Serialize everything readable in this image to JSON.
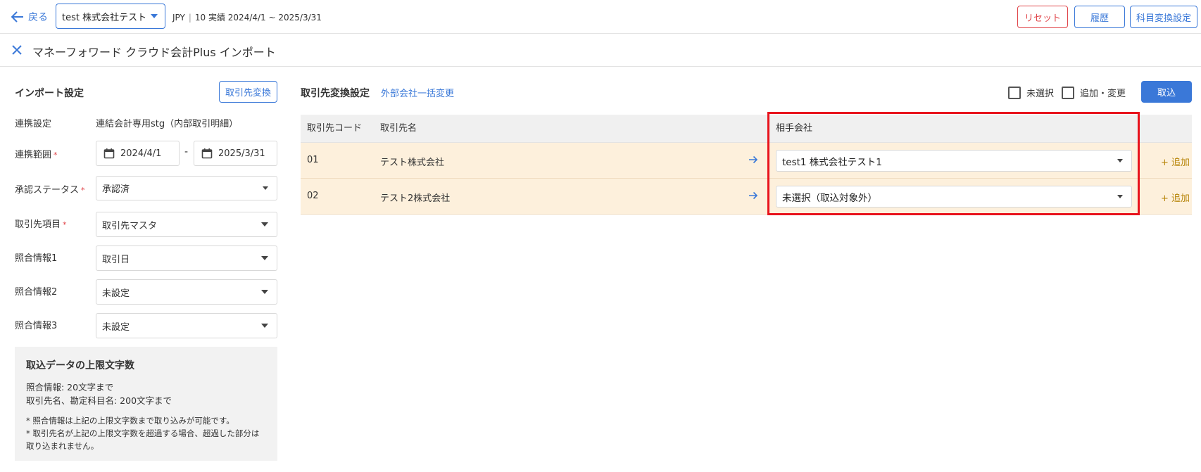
{
  "topbar": {
    "back_label": "戻る",
    "company": "test 株式会社テスト",
    "currency": "JPY",
    "period": "10 実績 2024/4/1 ~ 2025/3/31",
    "reset_label": "リセット",
    "history_label": "履歴",
    "account_mapping_label": "科目変換設定"
  },
  "subheader": {
    "title": "マネーフォワード クラウド会計Plus インポート"
  },
  "import_settings": {
    "title": "インポート設定",
    "partner_convert_button": "取引先変換",
    "link_label": "連携設定",
    "link_value": "連結会計専用stg（内部取引明細）",
    "range_label": "連携範囲",
    "range_required": "*",
    "range_start": "2024/4/1",
    "range_dash": "-",
    "range_end": "2025/3/31",
    "approval_label": "承認ステータス",
    "approval_required": "*",
    "approval_value": "承認済",
    "partner_item_label": "取引先項目",
    "partner_item_required": "*",
    "partner_item_value": "取引先マスタ",
    "match1_label": "照合情報1",
    "match1_value": "取引日",
    "match2_label": "照合情報2",
    "match2_value": "未設定",
    "match3_label": "照合情報3",
    "match3_value": "未設定"
  },
  "limits": {
    "title": "取込データの上限文字数",
    "line1": "照合情報: 20文字まで",
    "line2": "取引先名、勘定科目名: 200文字まで",
    "note1": "* 照合情報は上記の上限文字数まで取り込みが可能です。",
    "note2": "* 取引先名が上記の上限文字数を超過する場合、超過した部分は取り込まれません。"
  },
  "partner_settings": {
    "title": "取引先変換設定",
    "bulk_change_link": "外部会社一括変更",
    "unselected_label": "未選択",
    "add_change_label": "追加・変更",
    "import_button": "取込",
    "columns": {
      "code": "取引先コード",
      "name": "取引先名",
      "counterparty": "相手会社"
    },
    "rows": [
      {
        "code": "01",
        "name": "テスト株式会社",
        "counterparty": "test1 株式会社テスト1",
        "add": "+ 追加"
      },
      {
        "code": "02",
        "name": "テスト2株式会社",
        "counterparty": "未選択（取込対象外）",
        "add": "+ 追加"
      }
    ]
  },
  "colors": {
    "primary": "#3a78d8",
    "danger": "#e0454a",
    "row_bg": "#fdf0dc",
    "highlight": "#e8131c",
    "add_link": "#b8860b"
  }
}
